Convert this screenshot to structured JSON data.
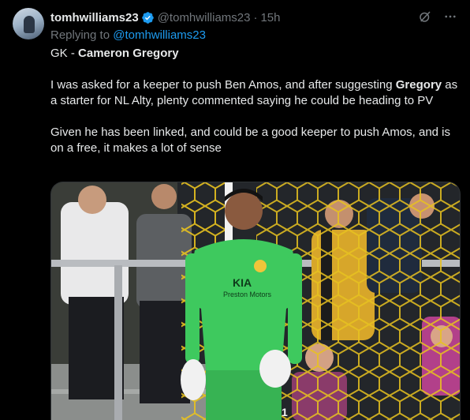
{
  "tweet": {
    "display_name": "tomhwilliams23",
    "handle": "@tomhwilliams23",
    "separator": "·",
    "time": "15h",
    "reply_prefix": "Replying to",
    "reply_to": "@tomhwilliams23",
    "line1_prefix": "GK - ",
    "line1_name": "Cameron Gregory",
    "para2_a": "I was asked for a keeper to push Ben Amos, and after suggesting ",
    "para2_b": "Gregory",
    "para2_c": " as a starter for NL Alty, plenty commented saying he could be heading to PV",
    "para3": "Given he has been linked, and could be a good keeper to push Amos, and is on a free, it makes a lot of sense"
  },
  "media": {
    "shirt_sponsor": "KIA",
    "shirt_sub": "Preston Motors",
    "shirt_number": "1",
    "kit_color": "#3ec95e",
    "net_color": "#e8c21f"
  },
  "colors": {
    "background": "#000000",
    "text": "#e7e9ea",
    "muted": "#71767b",
    "link": "#1d9bf0"
  },
  "icons": [
    "verified-badge-icon",
    "grok-icon",
    "more-options-icon"
  ]
}
